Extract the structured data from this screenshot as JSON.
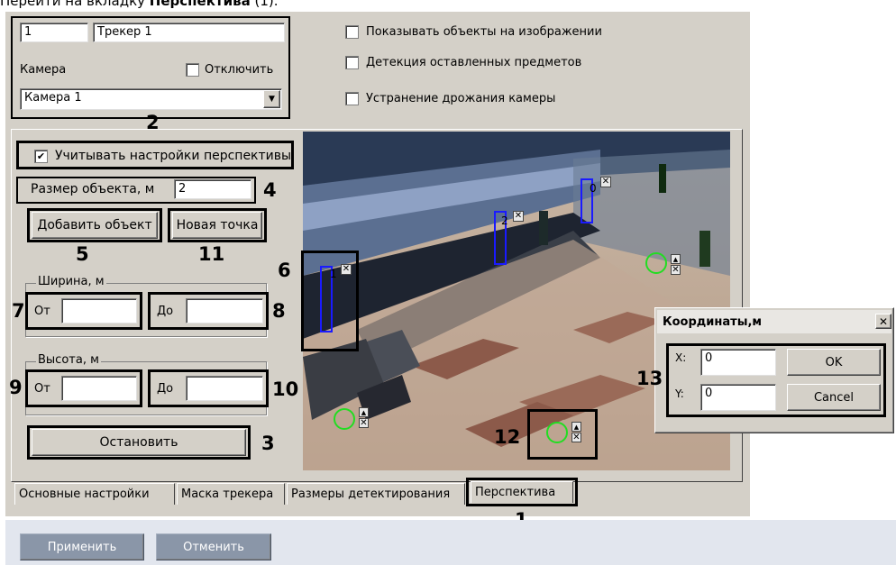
{
  "header_text": {
    "prefix": "Перейти на вкладку ",
    "bold": "Перспектива",
    "suffix": " (1)."
  },
  "top": {
    "tracker_id": "1",
    "tracker_name": "Трекер 1",
    "camera_label": "Камера",
    "disable_label": "Отключить",
    "camera_value": "Камера 1",
    "options": [
      "Показывать объекты на изображении",
      "Детекция оставленных предметов",
      "Устранение дрожания камеры"
    ]
  },
  "perspective": {
    "use_perspective_label": "Учитывать настройки перспективы",
    "object_size_label": "Размер объекта, м",
    "object_size_value": "2",
    "add_object_label": "Добавить объект",
    "new_point_label": "Новая точка",
    "width_group": "Ширина, м",
    "height_group": "Высота, м",
    "from_label": "От",
    "to_label": "До",
    "stop_label": "Остановить"
  },
  "callouts": [
    "1",
    "2",
    "3",
    "4",
    "5",
    "6",
    "7",
    "8",
    "9",
    "10",
    "11",
    "12",
    "13"
  ],
  "video_markers": [
    "0",
    "1",
    "2"
  ],
  "coords_dialog": {
    "title": "Координаты,м",
    "close_glyph": "✕",
    "x_label": "X:",
    "x_value": "0",
    "y_label": "Y:",
    "y_value": "0",
    "ok_label": "OK",
    "cancel_label": "Cancel"
  },
  "tabs": [
    "Основные настройки",
    "Маска трекера",
    "Размеры детектирования",
    "Перспектива"
  ],
  "footer": {
    "apply_label": "Применить",
    "cancel_label": "Отменить"
  },
  "icons": {
    "checkmark": "✔",
    "dropdown": "▼",
    "x_glyph": "✕",
    "up_glyph": "▲"
  }
}
